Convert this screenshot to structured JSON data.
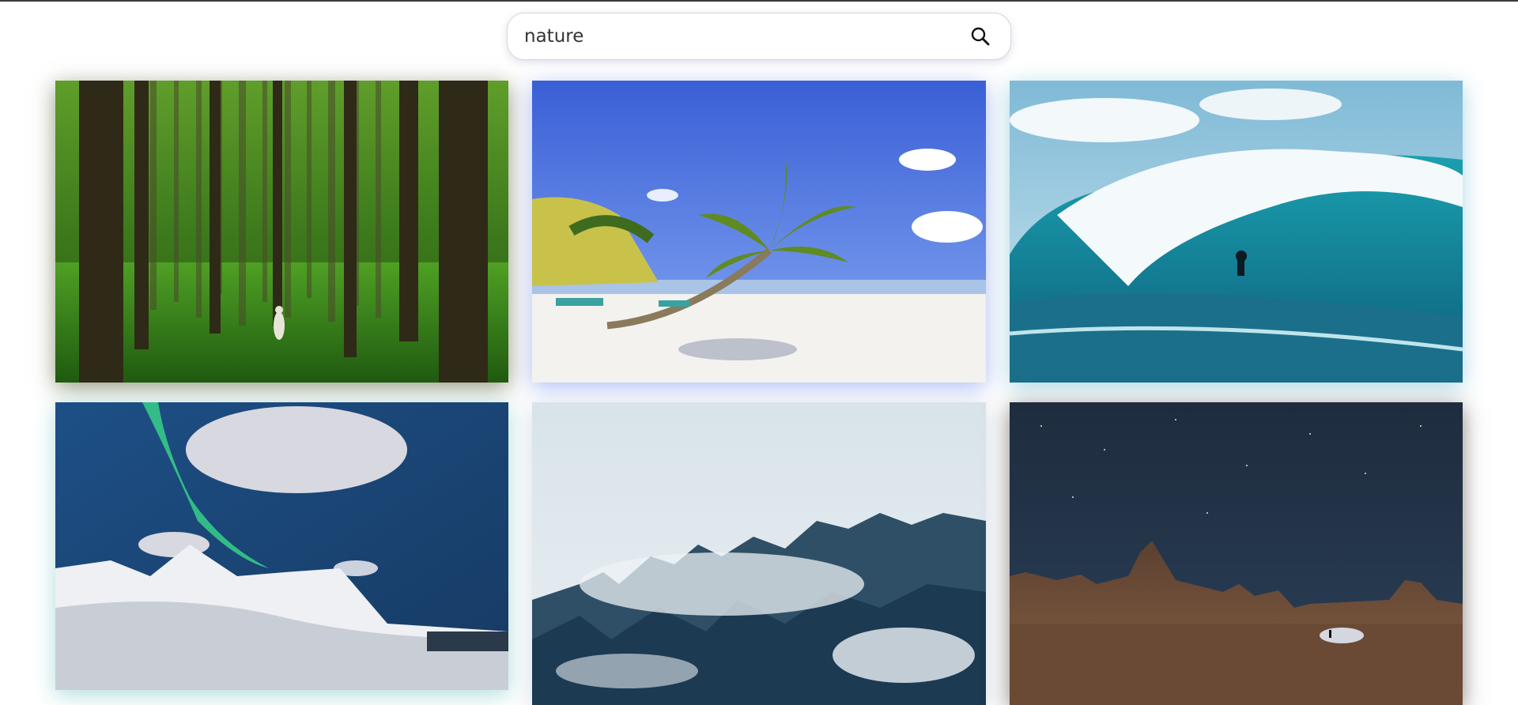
{
  "search": {
    "value": "nature",
    "placeholder": "Search",
    "icon": "search-icon"
  },
  "colors": {
    "search_border": "#d6d6dc",
    "top_line": "#3a3a3a"
  },
  "photos": [
    {
      "subject": "forest"
    },
    {
      "subject": "beach-palm"
    },
    {
      "subject": "ocean-wave"
    },
    {
      "subject": "aurora-mountains"
    },
    {
      "subject": "misty-forest"
    },
    {
      "subject": "desert-night"
    }
  ]
}
